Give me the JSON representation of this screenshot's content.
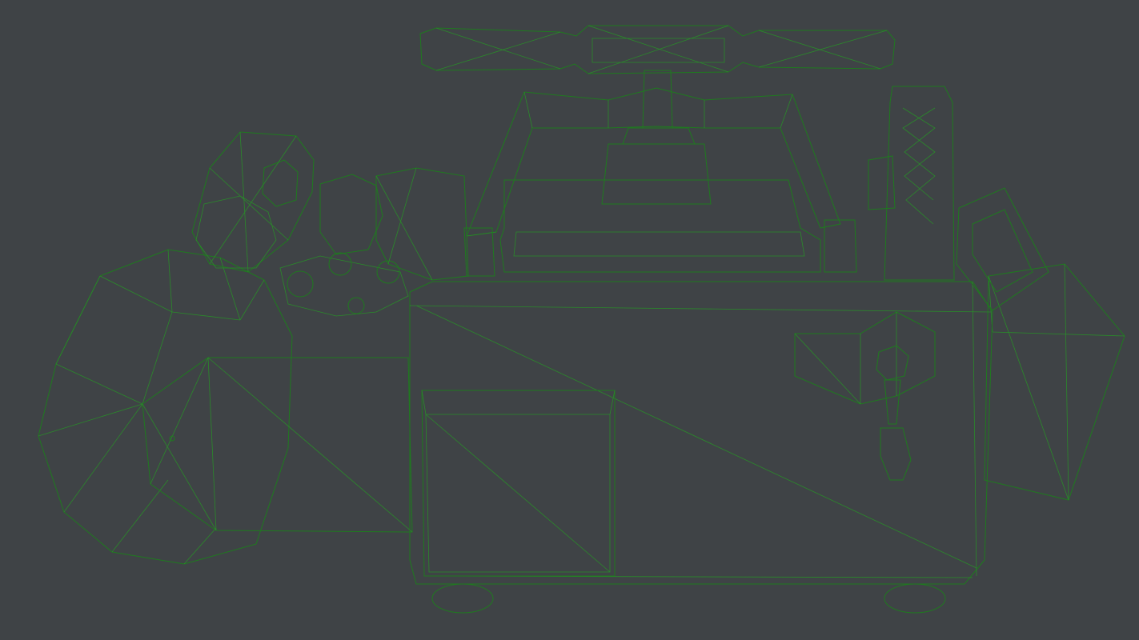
{
  "viewport": {
    "background_color": "#3f4346",
    "wire_color": "#1f7a1f",
    "surface_color": "#a9a9a9"
  }
}
